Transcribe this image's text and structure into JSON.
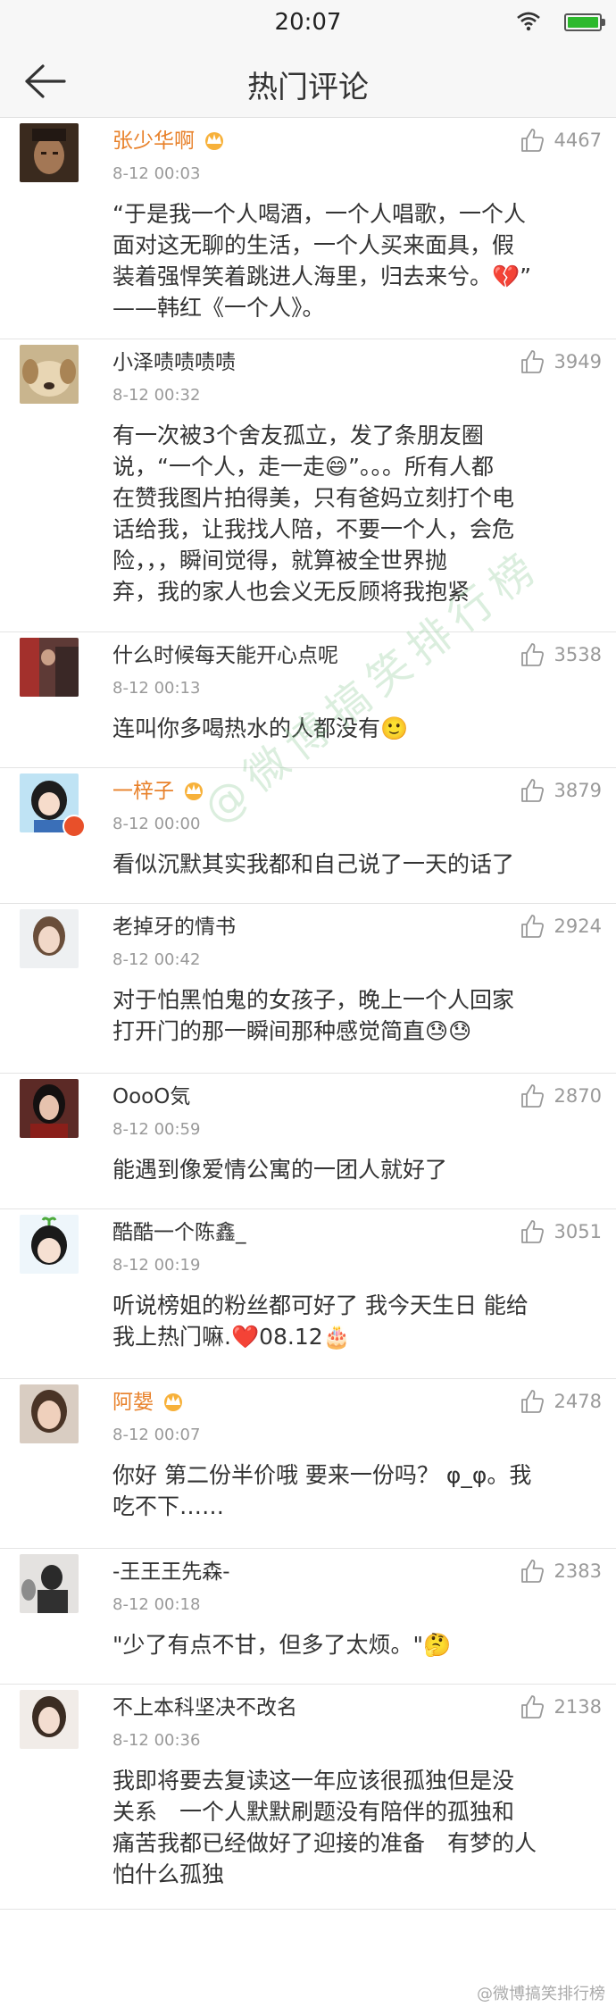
{
  "status": {
    "time": "20:07"
  },
  "header": {
    "title": "热门评论"
  },
  "comments": [
    {
      "name": "张少华啊",
      "vip": true,
      "time": "8-12 00:03",
      "likes": "4467",
      "lines": [
        "“于是我一个人喝酒，一个人唱歌，一个人",
        "面对这无聊的生活，一个人买来面具，假",
        "装着强悍笑着跳进人海里，归去来兮。💔”",
        "——韩红《一个人》。"
      ]
    },
    {
      "name": "小泽啧啧啧啧",
      "vip": false,
      "time": "8-12 00:32",
      "likes": "3949",
      "lines": [
        "有一次被3个舍友孤立，发了条朋友圈",
        "说，“一个人，走一走😄”。。。所有人都",
        "在赞我图片拍得美，只有爸妈立刻打个电",
        "话给我，让我找人陪，不要一个人，会危",
        "险，，，瞬间觉得，就算被全世界抛",
        "弃，我的家人也会义无反顾将我抱紧"
      ]
    },
    {
      "name": "什么时候每天能开心点呢",
      "vip": false,
      "time": "8-12 00:13",
      "likes": "3538",
      "lines": [
        "连叫你多喝热水的人都没有🙂"
      ]
    },
    {
      "name": "一梓子",
      "vip": true,
      "time": "8-12 00:00",
      "likes": "3879",
      "lines": [
        "看似沉默其实我都和自己说了一天的话了"
      ]
    },
    {
      "name": "老掉牙的情书",
      "vip": false,
      "time": "8-12 00:42",
      "likes": "2924",
      "lines": [
        "对于怕黑怕鬼的女孩子，晚上一个人回家",
        "打开门的那一瞬间那种感觉简直😓😓"
      ]
    },
    {
      "name": "OooO気",
      "vip": false,
      "time": "8-12 00:59",
      "likes": "2870",
      "lines": [
        "能遇到像爱情公寓的一团人就好了"
      ]
    },
    {
      "name": "酷酷一个陈鑫_",
      "vip": false,
      "time": "8-12 00:19",
      "likes": "3051",
      "lines": [
        "听说榜姐的粉丝都可好了 我今天生日 能给",
        "我上热门嘛.❤️08.12🎂"
      ]
    },
    {
      "name": "阿嫢",
      "vip": true,
      "time": "8-12 00:07",
      "likes": "2478",
      "lines": [
        "你好 第二份半价哦 要来一份吗？ φ_φ。我",
        "吃不下……"
      ]
    },
    {
      "name": "-王王王先森-",
      "vip": false,
      "time": "8-12 00:18",
      "likes": "2383",
      "lines": [
        "\"少了有点不甘，但多了太烦。\"🤔"
      ]
    },
    {
      "name": "不上本科坚决不改名",
      "vip": false,
      "time": "8-12 00:36",
      "likes": "2138",
      "lines": [
        "我即将要去复读这一年应该很孤独但是没",
        "关系　一个人默默刷题没有陪伴的孤独和",
        "痛苦我都已经做好了迎接的准备　有梦的人",
        "怕什么孤独"
      ]
    }
  ],
  "watermark": "@微博搞笑排行榜",
  "footer": "@微博搞笑排行榜"
}
